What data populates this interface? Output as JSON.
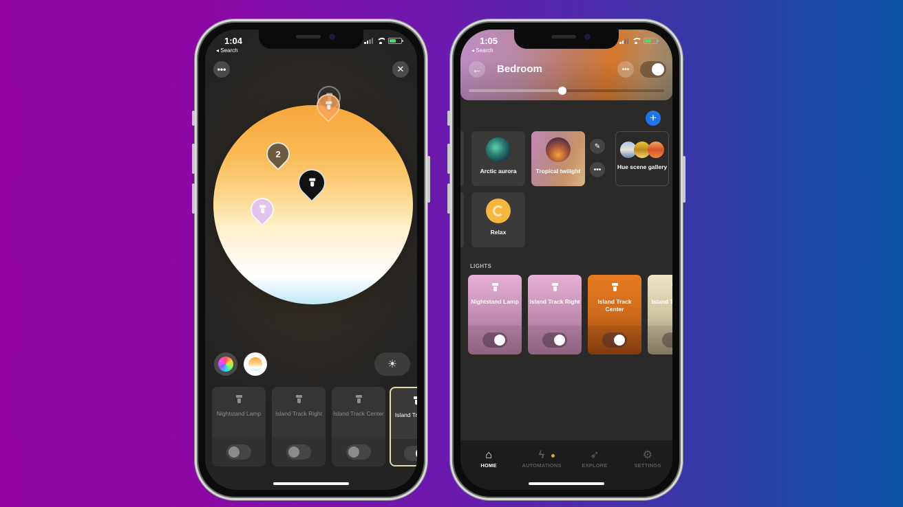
{
  "background": {
    "gradient_from": "#9103a3",
    "gradient_to": "#0a54a4"
  },
  "left_phone": {
    "status": {
      "time": "1:04",
      "back_label": "◂ Search",
      "location_icon": "➚"
    },
    "more_button_label": "•••",
    "close_button_label": "✕",
    "color_picker": {
      "mode": "white-ambiance",
      "pins": [
        {
          "id": "top-faded-pin",
          "label": "",
          "color": "#f7a25a"
        },
        {
          "id": "group-pin",
          "label": "2",
          "color": "#6b5a40"
        },
        {
          "id": "selected-pin",
          "label": "",
          "color": "#111111"
        },
        {
          "id": "pink-pin",
          "label": "",
          "color": "#e4c3ea"
        }
      ]
    },
    "brightness_icon": "☀",
    "lights": [
      {
        "name": "Nightstand Lamp",
        "on": false,
        "selected": false
      },
      {
        "name": "Island Track Right",
        "on": false,
        "selected": false
      },
      {
        "name": "Island Track Center",
        "on": false,
        "selected": false
      },
      {
        "name": "Island Track Left",
        "on": true,
        "selected": true
      }
    ]
  },
  "right_phone": {
    "status": {
      "time": "1:05",
      "back_label": "◂ Search",
      "location_icon": "➚"
    },
    "header": {
      "back_icon": "←",
      "title": "Bedroom",
      "more_label": "•••",
      "room_on": true,
      "brightness": 0.48
    },
    "add_scene_label": "+",
    "scenes": [
      {
        "name": "Arctic aurora",
        "active": false
      },
      {
        "name": "Tropical twilight",
        "active": true
      },
      {
        "name": "Hue scene gallery",
        "active": false
      },
      {
        "name": "Relax",
        "active": false
      }
    ],
    "scene_edit_icon": "✎",
    "scene_more_label": "•••",
    "lights_section_label": "LIGHTS",
    "lights": [
      {
        "name": "Nightstand Lamp",
        "on": true,
        "color": "#c58fb8"
      },
      {
        "name": "Island Track Right",
        "on": true,
        "color": "#c58fb8"
      },
      {
        "name": "Island Track Center",
        "on": true,
        "color": "#d2701f"
      },
      {
        "name": "Island Track Left",
        "on": true,
        "color": "#cfc7a2"
      }
    ],
    "tabs": [
      {
        "label": "HOME",
        "icon": "⌂",
        "active": true
      },
      {
        "label": "AUTOMATIONS",
        "icon": "ϟ",
        "active": false,
        "badge": true
      },
      {
        "label": "EXPLORE",
        "icon": "➶",
        "active": false
      },
      {
        "label": "SETTINGS",
        "icon": "⚙",
        "active": false
      }
    ],
    "accent_color": "#1f74e6"
  }
}
